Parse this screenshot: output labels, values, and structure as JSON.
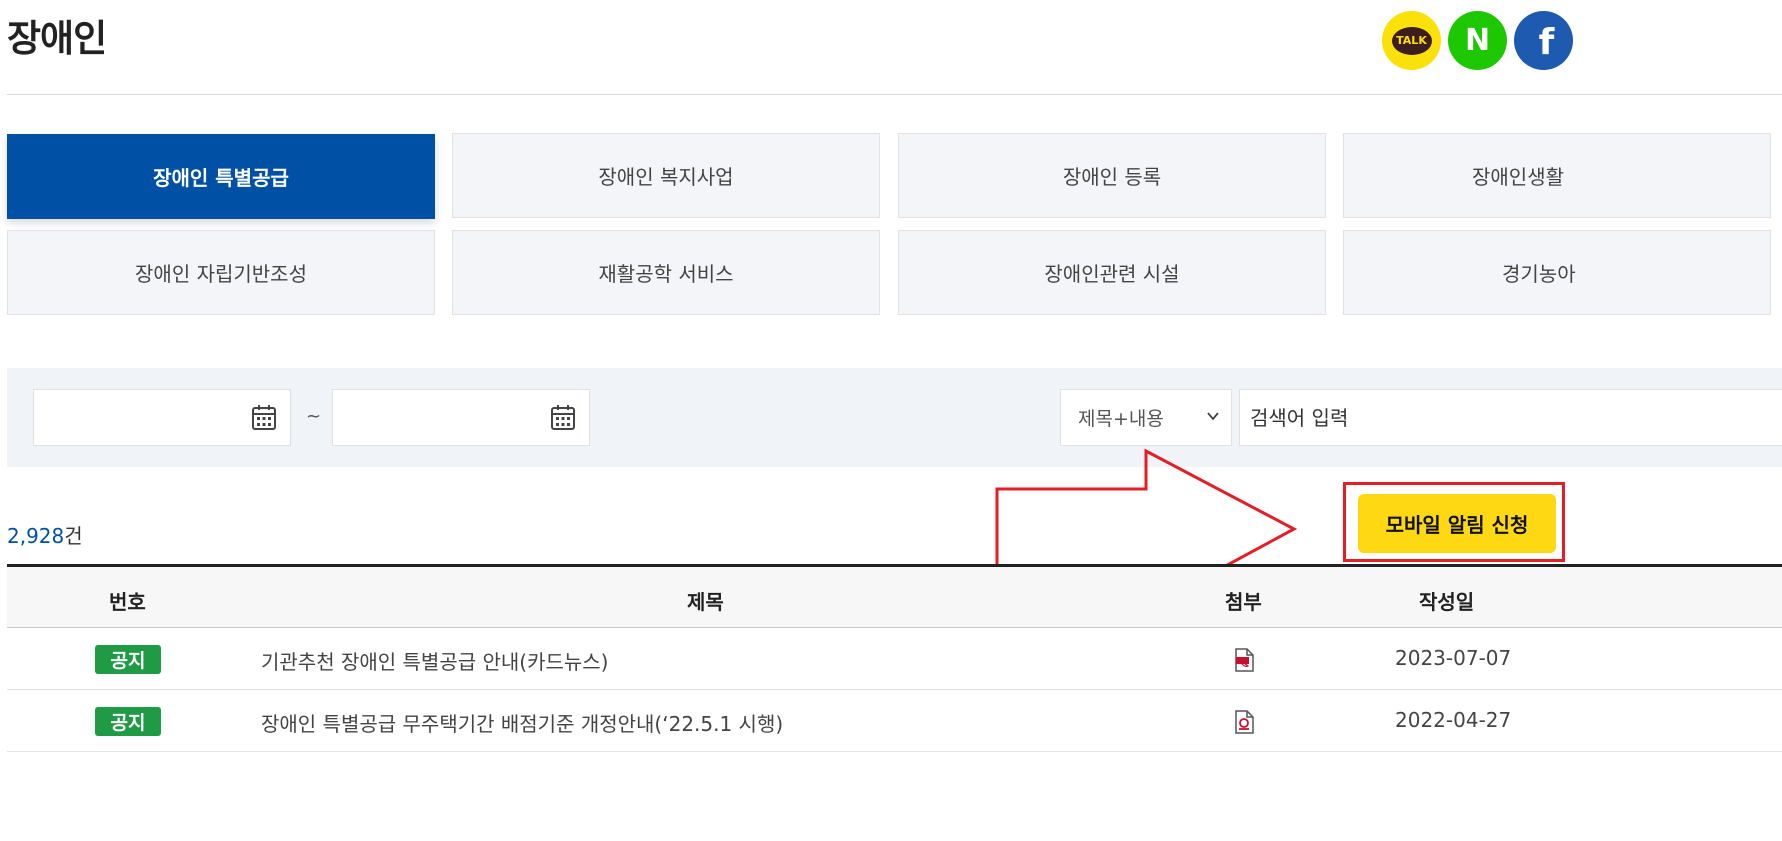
{
  "page": {
    "title": "장애인"
  },
  "share": {
    "kakao_label": "TALK",
    "naver_label": "N",
    "facebook_label": "f"
  },
  "tabs": [
    {
      "label": "장애인 특별공급",
      "active": true
    },
    {
      "label": "장애인 복지사업"
    },
    {
      "label": "장애인 등록"
    },
    {
      "label": "장애인생활"
    },
    {
      "label": "장애인 자립기반조성"
    },
    {
      "label": "재활공학 서비스"
    },
    {
      "label": "장애인관련 시설"
    },
    {
      "label": "경기농아"
    }
  ],
  "search": {
    "start_date": "",
    "end_date": "",
    "tilde": "~",
    "scope_selected": "제목+내용",
    "placeholder": "검색어 입력"
  },
  "result": {
    "count": "2,928",
    "unit": "건"
  },
  "mobile_alert_button": "모바일 알림 신청",
  "table": {
    "headers": {
      "no": "번호",
      "title": "제목",
      "attach": "첨부",
      "date": "작성일"
    },
    "rows": [
      {
        "badge": "공지",
        "title": "기관추천 장애인 특별공급 안내(카드뉴스)",
        "attach_icon": "pdf-file-icon",
        "date": "2023-07-07"
      },
      {
        "badge": "공지",
        "title": "장애인 특별공급 무주택기간 배점기준 개정안내(‘22.5.1 시행)",
        "attach_icon": "hwp-file-icon",
        "date": "2022-04-27"
      }
    ]
  },
  "colors": {
    "active_tab": "#0050a5",
    "badge": "#1f9a45",
    "mobile_button": "#fdd813",
    "annotation_red": "#e41e26"
  }
}
